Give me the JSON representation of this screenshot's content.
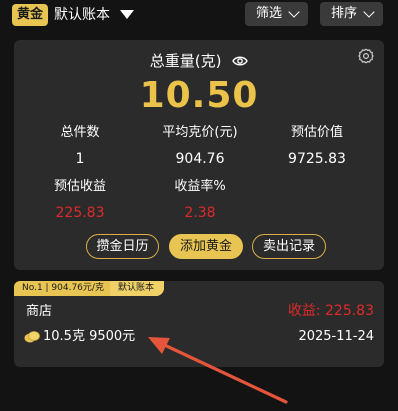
{
  "topbar": {
    "book_badge": "黄金",
    "book_name": "默认账本",
    "filter_label": "筛选",
    "sort_label": "排序"
  },
  "summary": {
    "title": "总重量(克)",
    "total_weight": "10.50",
    "stats": {
      "total_count_label": "总件数",
      "total_count_value": "1",
      "avg_price_label": "平均克价(元)",
      "avg_price_value": "904.76",
      "est_value_label": "预估价值",
      "est_value_value": "9725.83",
      "est_profit_label": "预估收益",
      "est_profit_value": "225.83",
      "profit_rate_label": "收益率%",
      "profit_rate_value": "2.38"
    },
    "buttons": {
      "calendar": "攒金日历",
      "add": "添加黄金",
      "sell": "卖出记录"
    }
  },
  "record": {
    "tag_main": "No.1 | 904.76元/克",
    "tag_book": "默认账本",
    "store": "商店",
    "profit": "收益: 225.83",
    "detail": "10.5克 9500元",
    "date": "2025-11-24"
  },
  "colors": {
    "background": "#131313",
    "card": "#2b2b2b",
    "gold": "#e8c552",
    "loss_red": "#e02a2a",
    "annotation_arrow": "#e4553c"
  },
  "icons": [
    "caret-down-icon",
    "chevron-down-icon",
    "eye-icon",
    "gear-icon",
    "gold-coin-icon",
    "annotation-arrow"
  ]
}
